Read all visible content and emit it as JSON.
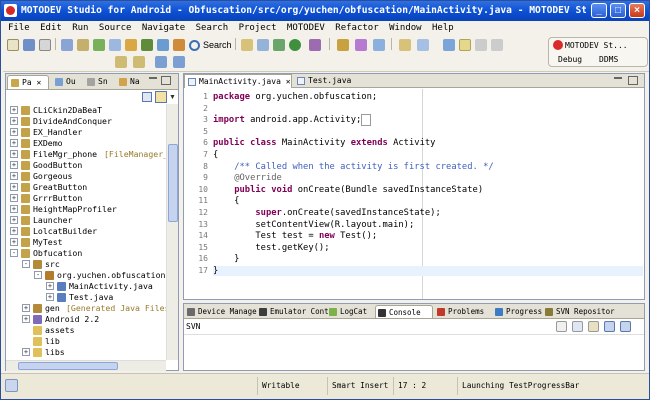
{
  "window": {
    "title": "MOTODEV Studio for Android - Obfuscation/src/org/yuchen/obfuscation/MainActivity.java - MOTODEV Studio for A...",
    "minimize": "_",
    "maximize": "□",
    "close": "×"
  },
  "menu": [
    "File",
    "Edit",
    "Run",
    "Source",
    "Navigate",
    "Search",
    "Project",
    "MOTODEV",
    "Refactor",
    "Window",
    "Help"
  ],
  "toolbar": {
    "search_label": "Search",
    "perspective_active": "MOTODEV St...",
    "perspective_debug": "Debug",
    "perspective_ddms": "DDMS"
  },
  "left_tabs": [
    {
      "label": "Pa",
      "icon": "package-explorer-icon"
    },
    {
      "label": "Ou",
      "icon": "outline-icon"
    },
    {
      "label": "Sn",
      "icon": "snippets-icon"
    },
    {
      "label": "Na",
      "icon": "navigator-icon"
    }
  ],
  "tree": [
    {
      "label": "CLiCkin2DaBeaT",
      "level": 0,
      "expander": "+",
      "icon": "project-icon"
    },
    {
      "label": "DivideAndConquer",
      "level": 0,
      "expander": "+",
      "icon": "project-icon"
    },
    {
      "label": "EX_Handler",
      "level": 0,
      "expander": "+",
      "icon": "project-icon"
    },
    {
      "label": "EXDemo",
      "level": 0,
      "expander": "+",
      "icon": "project-icon"
    },
    {
      "label": "FileMgr_phone",
      "annotation": "[FileManager_phone]",
      "level": 0,
      "expander": "+",
      "icon": "project-icon"
    },
    {
      "label": "GoodButton",
      "level": 0,
      "expander": "+",
      "icon": "project-icon"
    },
    {
      "label": "Gorgeous",
      "level": 0,
      "expander": "+",
      "icon": "project-icon"
    },
    {
      "label": "GreatButton",
      "level": 0,
      "expander": "+",
      "icon": "project-icon"
    },
    {
      "label": "GrrrButton",
      "level": 0,
      "expander": "+",
      "icon": "project-icon"
    },
    {
      "label": "HeightMapProfiler",
      "level": 0,
      "expander": "+",
      "icon": "project-icon"
    },
    {
      "label": "Launcher",
      "level": 0,
      "expander": "+",
      "icon": "project-icon"
    },
    {
      "label": "LolcatBuilder",
      "level": 0,
      "expander": "+",
      "icon": "project-icon"
    },
    {
      "label": "MyTest",
      "level": 0,
      "expander": "+",
      "icon": "project-icon"
    },
    {
      "label": "Obfucation",
      "level": 0,
      "expander": "-",
      "icon": "project-icon"
    },
    {
      "label": "src",
      "level": 1,
      "expander": "-",
      "icon": "source-folder-icon"
    },
    {
      "label": "org.yuchen.obfuscation",
      "level": 2,
      "expander": "-",
      "icon": "package-icon"
    },
    {
      "label": "MainActivity.java",
      "level": 3,
      "expander": "+",
      "icon": "java-file-icon"
    },
    {
      "label": "Test.java",
      "level": 3,
      "expander": "+",
      "icon": "java-file-icon"
    },
    {
      "label": "gen",
      "annotation": "[Generated Java Files]",
      "level": 1,
      "expander": "+",
      "icon": "source-folder-icon"
    },
    {
      "label": "Android 2.2",
      "level": 1,
      "expander": "+",
      "icon": "library-icon"
    },
    {
      "label": "assets",
      "level": 1,
      "expander": "",
      "icon": "folder-icon"
    },
    {
      "label": "lib",
      "level": 1,
      "expander": "",
      "icon": "folder-icon"
    },
    {
      "label": "libs",
      "level": 1,
      "expander": "+",
      "icon": "folder-icon"
    }
  ],
  "editor_tabs": [
    {
      "label": "MainActivity.java",
      "active": true
    },
    {
      "label": "Test.java",
      "active": false
    }
  ],
  "code_lines": [
    {
      "n": "1",
      "html": "<span class='kw'>package</span> org.yuchen.obfuscation;"
    },
    {
      "n": "2",
      "html": ""
    },
    {
      "n": "3",
      "html": "<span class='kw'>import</span> android.app.Activity;<span style='border:1px solid #999;padding:0 1px'> </span>"
    },
    {
      "n": "5",
      "html": ""
    },
    {
      "n": "6",
      "html": "<span class='kw'>public class</span> MainActivity <span class='kw'>extends</span> Activity"
    },
    {
      "n": "7",
      "html": "{"
    },
    {
      "n": "8",
      "html": "    <span class='cm'>/** Called when the activity is first created. */</span>"
    },
    {
      "n": "9",
      "html": "    <span class='an'>@Override</span>"
    },
    {
      "n": "10",
      "html": "    <span class='kw'>public void</span> onCreate(Bundle savedInstanceState)"
    },
    {
      "n": "11",
      "html": "    {"
    },
    {
      "n": "12",
      "html": "        <span class='kw'>super</span>.onCreate(savedInstanceState);"
    },
    {
      "n": "13",
      "html": "        setContentView(R.layout.main);"
    },
    {
      "n": "14",
      "html": "        Test test = <span class='kw'>new</span> Test();"
    },
    {
      "n": "15",
      "html": "        test.getKey();"
    },
    {
      "n": "16",
      "html": "    }"
    },
    {
      "n": "17",
      "html": "}"
    }
  ],
  "bottom_tabs": [
    {
      "label": "Device Manage",
      "icon": "device-icon"
    },
    {
      "label": "Emulator Cont",
      "icon": "emulator-icon"
    },
    {
      "label": "LogCat",
      "icon": "logcat-icon"
    },
    {
      "label": "Console",
      "icon": "console-icon",
      "active": true
    },
    {
      "label": "Problems",
      "icon": "problems-icon"
    },
    {
      "label": "Progress",
      "icon": "progress-icon"
    },
    {
      "label": "SVN Repositor",
      "icon": "svn-icon"
    }
  ],
  "console": {
    "title": "SVN"
  },
  "status": {
    "writable": "Writable",
    "insert_mode": "Smart Insert",
    "position": "17 : 2",
    "progress": "Launching TestProgressBar"
  },
  "colors": {
    "title_bar": "#0b4fd3",
    "keyword": "#7f0055",
    "comment": "#3f5fbf"
  }
}
